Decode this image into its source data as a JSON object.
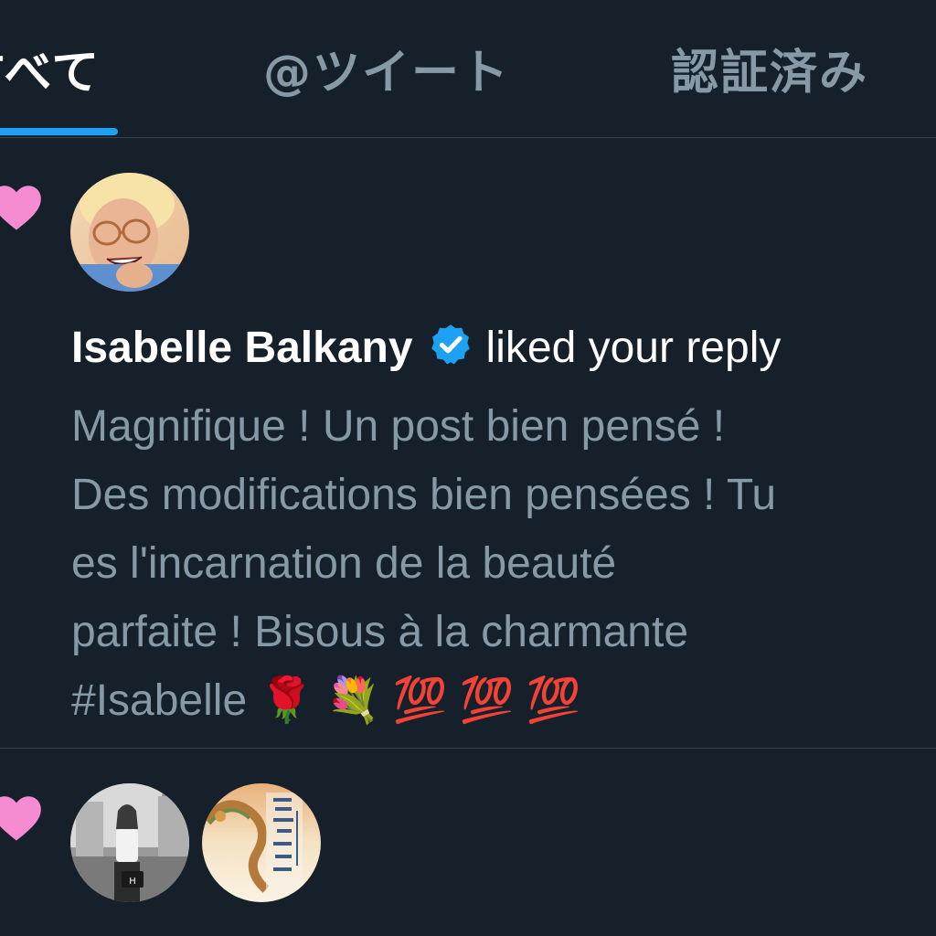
{
  "tabs": [
    {
      "label": "すべて",
      "active": true
    },
    {
      "label": "@ツイート",
      "active": false
    },
    {
      "label": "認証済み",
      "active": false
    }
  ],
  "colors": {
    "background": "#15202b",
    "divider": "#38444d",
    "accent": "#1da1f2",
    "heart": "#f58bd0",
    "primary_text": "#ffffff",
    "secondary_text": "#8899a6"
  },
  "notifications": [
    {
      "type": "like",
      "icon": "heart-icon",
      "user_name": "Isabelle Balkany",
      "verified": true,
      "action": "liked your reply",
      "tweet_text": "Magnifique ! Un post bien pensé !\nDes modifications bien pensées ! Tu\nes l'incarnation de la beauté\nparfaite ! Bisous à la charmante\n#Isabelle 🌹 💐 💯 💯 💯"
    },
    {
      "type": "like",
      "icon": "heart-icon",
      "avatars": [
        "woman-photo-avatar",
        "dragon-book-cover-avatar"
      ]
    }
  ]
}
